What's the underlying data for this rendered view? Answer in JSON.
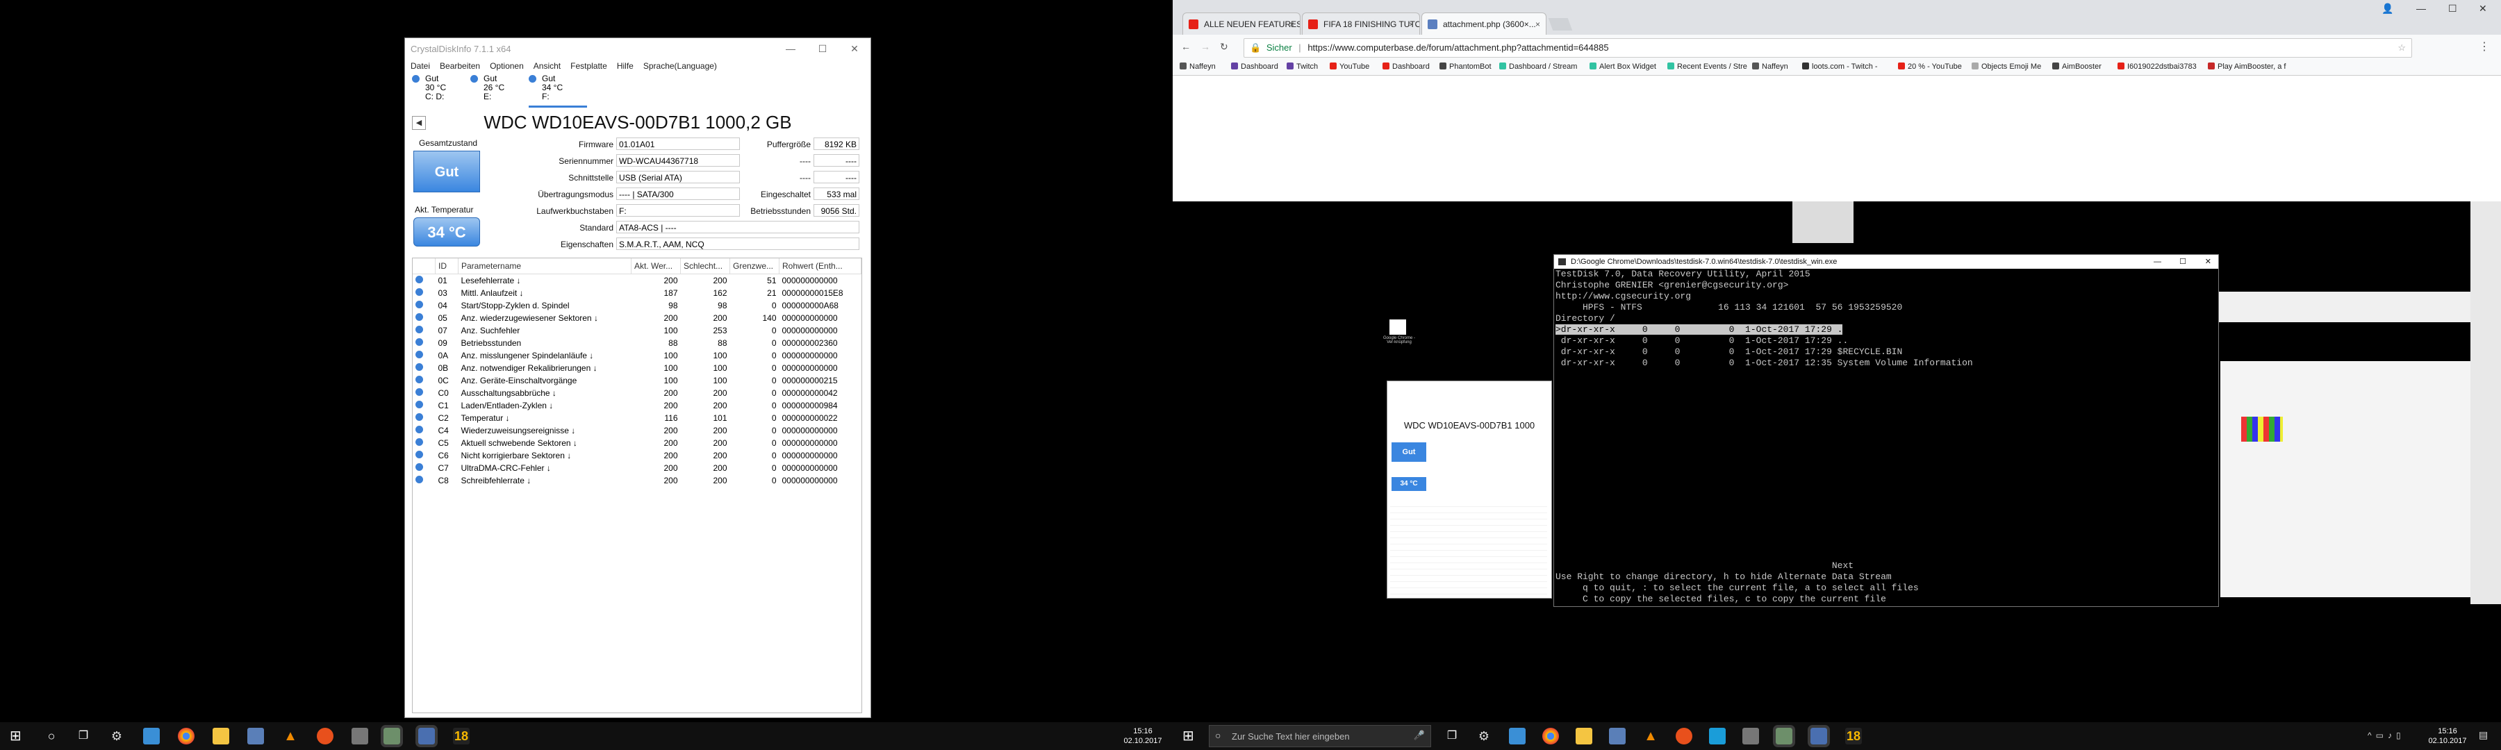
{
  "cdi": {
    "title": "CrystalDiskInfo 7.1.1 x64",
    "menu": [
      "Datei",
      "Bearbeiten",
      "Optionen",
      "Ansicht",
      "Festplatte",
      "Hilfe",
      "Sprache(Language)"
    ],
    "disks": [
      {
        "status": "Gut",
        "temp": "30 °C",
        "letter": "C: D:"
      },
      {
        "status": "Gut",
        "temp": "26 °C",
        "letter": "E:"
      },
      {
        "status": "Gut",
        "temp": "34 °C",
        "letter": "F:"
      }
    ],
    "model": "WDC WD10EAVS-00D7B1 1000,2 GB",
    "health_label": "Gesamtzustand",
    "health_value": "Gut",
    "temp_label": "Akt. Temperatur",
    "temp_value": "34 °C",
    "fields": {
      "firmware_label": "Firmware",
      "firmware": "01.01A01",
      "serial_label": "Seriennummer",
      "serial": "WD-WCAU44367718",
      "interface_label": "Schnittstelle",
      "interface": "USB (Serial ATA)",
      "transfer_label": "Übertragungsmodus",
      "transfer": "---- | SATA/300",
      "letters_label": "Laufwerkbuchstaben",
      "letters": "F:",
      "standard_label": "Standard",
      "standard": "ATA8-ACS | ----",
      "features_label": "Eigenschaften",
      "features": "S.M.A.R.T., AAM, NCQ",
      "buffer_label": "Puffergröße",
      "buffer": "8192 KB",
      "r1_label": "----",
      "r1": "----",
      "r2_label": "----",
      "r2": "----",
      "poweron_count_label": "Eingeschaltet",
      "poweron_count": "533 mal",
      "hours_label": "Betriebsstunden",
      "hours": "9056 Std."
    },
    "smart_headers": [
      "ID",
      "Parametername",
      "Akt. Wer...",
      "Schlecht...",
      "Grenzwe...",
      "Rohwert (Enth..."
    ],
    "smart_rows": [
      [
        "01",
        "Lesefehlerrate ↓",
        "200",
        "200",
        "51",
        "000000000000"
      ],
      [
        "03",
        "Mittl. Anlaufzeit ↓",
        "187",
        "162",
        "21",
        "00000000015E8"
      ],
      [
        "04",
        "Start/Stopp-Zyklen d. Spindel",
        "98",
        "98",
        "0",
        "000000000A68"
      ],
      [
        "05",
        "Anz. wiederzugewiesener Sektoren ↓",
        "200",
        "200",
        "140",
        "000000000000"
      ],
      [
        "07",
        "Anz. Suchfehler",
        "100",
        "253",
        "0",
        "000000000000"
      ],
      [
        "09",
        "Betriebsstunden",
        "88",
        "88",
        "0",
        "000000002360"
      ],
      [
        "0A",
        "Anz. misslungener Spindelanläufe ↓",
        "100",
        "100",
        "0",
        "000000000000"
      ],
      [
        "0B",
        "Anz. notwendiger Rekalibrierungen ↓",
        "100",
        "100",
        "0",
        "000000000000"
      ],
      [
        "0C",
        "Anz. Geräte-Einschaltvorgänge",
        "100",
        "100",
        "0",
        "000000000215"
      ],
      [
        "C0",
        "Ausschaltungsabbrüche ↓",
        "200",
        "200",
        "0",
        "000000000042"
      ],
      [
        "C1",
        "Laden/Entladen-Zyklen ↓",
        "200",
        "200",
        "0",
        "000000000984"
      ],
      [
        "C2",
        "Temperatur ↓",
        "116",
        "101",
        "0",
        "000000000022"
      ],
      [
        "C4",
        "Wiederzuweisungsereignisse ↓",
        "200",
        "200",
        "0",
        "000000000000"
      ],
      [
        "C5",
        "Aktuell schwebende Sektoren ↓",
        "200",
        "200",
        "0",
        "000000000000"
      ],
      [
        "C6",
        "Nicht korrigierbare Sektoren ↓",
        "200",
        "200",
        "0",
        "000000000000"
      ],
      [
        "C7",
        "UltraDMA-CRC-Fehler ↓",
        "200",
        "200",
        "0",
        "000000000000"
      ],
      [
        "C8",
        "Schreibfehlerrate ↓",
        "200",
        "200",
        "0",
        "000000000000"
      ]
    ]
  },
  "left_taskbar": {
    "time": "15:16",
    "date": "02.10.2017",
    "badge": "18"
  },
  "right_taskbar": {
    "search_placeholder": "Zur Suche Text hier eingeben",
    "time": "15:16",
    "date": "02.10.2017",
    "badge": "18"
  },
  "chrome": {
    "tabs": [
      "ALLE NEUEN FEATURES | ...",
      "FIFA 18 FINISHING TUTO...",
      "attachment.php (3600×..."
    ],
    "secure_label": "Sicher",
    "url": "https://www.computerbase.de/forum/attachment.php?attachmentid=644885",
    "bookmarks": [
      "Naffeyn",
      "Dashboard",
      "Twitch",
      "YouTube",
      "Dashboard",
      "PhantomBot",
      "Dashboard / Stream",
      "Alert Box Widget",
      "Recent Events / Stre",
      "Naffeyn",
      "loots.com - Twitch -",
      "20 % - YouTube",
      "Objects Emoji Me",
      "AimBooster",
      "I6019022dstbai3783",
      "Play AimBooster, a f"
    ]
  },
  "terminal": {
    "title": "D:\\Google Chrome\\Downloads\\testdisk-7.0.win64\\testdisk-7.0\\testdisk_win.exe",
    "lines": [
      "TestDisk 7.0, Data Recovery Utility, April 2015",
      "Christophe GRENIER <grenier@cgsecurity.org>",
      "http://www.cgsecurity.org",
      "     HPFS - NTFS              16 113 34 121601  57 56 1953259520",
      "Directory /",
      ""
    ],
    "selected": ">dr-xr-xr-x     0     0         0  1-Oct-2017 17:29 .",
    "entries": [
      " dr-xr-xr-x     0     0         0  1-Oct-2017 17:29 ..",
      " dr-xr-xr-x     0     0         0  1-Oct-2017 17:29 $RECYCLE.BIN",
      " dr-xr-xr-x     0     0         0  1-Oct-2017 12:35 System Volume Information"
    ],
    "footer": [
      "                                                   Next",
      "Use Right to change directory, h to hide Alternate Data Stream",
      "     q to quit, : to select the current file, a to select all files",
      "     C to copy the selected files, c to copy the current file"
    ]
  },
  "bg_window": {
    "model": "WDC WD10EAVS-00D7B1 1000",
    "health": "Gut",
    "temp": "34 °C"
  },
  "desktop_icon": {
    "label": "Google Chrome - Ver-knüpfung"
  }
}
